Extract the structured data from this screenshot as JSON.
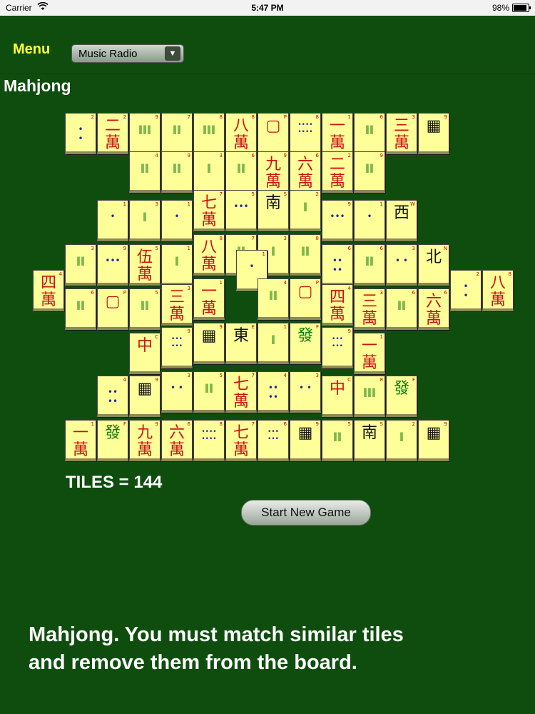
{
  "status_bar": {
    "carrier": "Carrier",
    "time": "5:47 PM",
    "battery": "98%"
  },
  "header": {
    "menu_label": "Menu",
    "radio_select_value": "Music Radio",
    "title": "Mahjong"
  },
  "board": {
    "tiles": [
      {
        "face": "•\n•",
        "style": "blue small",
        "corner": "2"
      },
      {
        "face": "二\n萬",
        "style": "red",
        "corner": "2"
      },
      {
        "face": "‖‖‖",
        "style": "green small",
        "corner": "9"
      },
      {
        "face": "‖‖",
        "style": "green small",
        "corner": "7"
      },
      {
        "face": "‖‖‖",
        "style": "green small",
        "corner": "8"
      },
      {
        "face": "八\n萬",
        "style": "red",
        "corner": "8"
      },
      {
        "face": "▢",
        "style": "red",
        "corner": "P"
      },
      {
        "face": "••••\n••••",
        "style": "blue tiny",
        "corner": "8"
      },
      {
        "face": "一\n萬",
        "style": "red",
        "corner": "1"
      },
      {
        "face": "‖‖",
        "style": "green small",
        "corner": "6"
      },
      {
        "face": "三\n萬",
        "style": "red",
        "corner": "3"
      },
      {
        "face": "▦",
        "style": "black",
        "corner": "9"
      },
      {
        "face": "‖‖",
        "style": "green small",
        "corner": "4"
      },
      {
        "face": "‖‖",
        "style": "green small",
        "corner": "9"
      },
      {
        "face": "‖",
        "style": "green small",
        "corner": "3"
      },
      {
        "face": "‖‖",
        "style": "green small",
        "corner": "6"
      },
      {
        "face": "九\n萬",
        "style": "red",
        "corner": "9"
      },
      {
        "face": "六\n萬",
        "style": "red",
        "corner": "6"
      },
      {
        "face": "二\n萬",
        "style": "red",
        "corner": "2"
      },
      {
        "face": "‖‖",
        "style": "green small",
        "corner": "9"
      },
      {
        "face": "•",
        "style": "blue small",
        "corner": "1"
      },
      {
        "face": "‖",
        "style": "green small",
        "corner": "3"
      },
      {
        "face": "•",
        "style": "blue small",
        "corner": "1"
      },
      {
        "face": "七\n萬",
        "style": "red",
        "corner": "7"
      },
      {
        "face": "•••",
        "style": "blue small",
        "corner": "5"
      },
      {
        "face": "南",
        "style": "black",
        "corner": "S"
      },
      {
        "face": "‖",
        "style": "green small",
        "corner": "2"
      },
      {
        "face": "•••",
        "style": "blue small",
        "corner": "9"
      },
      {
        "face": "•",
        "style": "blue small",
        "corner": "1"
      },
      {
        "face": "西",
        "style": "black",
        "corner": "W"
      },
      {
        "face": "‖‖",
        "style": "green small",
        "corner": "3"
      },
      {
        "face": "•••",
        "style": "blue small",
        "corner": "9"
      },
      {
        "face": "伍\n萬",
        "style": "red",
        "corner": "5"
      },
      {
        "face": "‖",
        "style": "green small",
        "corner": "1"
      },
      {
        "face": "八\n萬",
        "style": "red",
        "corner": "8"
      },
      {
        "face": "‖",
        "style": "green small",
        "corner": "3"
      },
      {
        "face": "‖‖",
        "style": "green small",
        "corner": "8"
      },
      {
        "face": "••\n••",
        "style": "blue small",
        "corner": "6"
      },
      {
        "face": "‖‖",
        "style": "green small",
        "corner": "6"
      },
      {
        "face": "• •",
        "style": "blue small",
        "corner": "3"
      },
      {
        "face": "北",
        "style": "black",
        "corner": "N"
      },
      {
        "face": "‖‖",
        "style": "green small",
        "corner": "7"
      },
      {
        "face": "四\n萬",
        "style": "red",
        "corner": "4"
      },
      {
        "face": "•",
        "style": "blue small",
        "corner": "1"
      },
      {
        "face": "•\n•",
        "style": "blue small",
        "corner": "2"
      },
      {
        "face": "八\n萬",
        "style": "red",
        "corner": "8"
      },
      {
        "face": "‖‖",
        "style": "green small",
        "corner": "6"
      },
      {
        "face": "▢",
        "style": "red",
        "corner": "P"
      },
      {
        "face": "‖‖",
        "style": "green small",
        "corner": "5"
      },
      {
        "face": "三\n萬",
        "style": "red",
        "corner": "3"
      },
      {
        "face": "一\n萬",
        "style": "red",
        "corner": "1"
      },
      {
        "face": "‖‖",
        "style": "green small",
        "corner": "4"
      },
      {
        "face": "▢",
        "style": "red",
        "corner": "P"
      },
      {
        "face": "四\n萬",
        "style": "red",
        "corner": "4"
      },
      {
        "face": "三\n萬",
        "style": "red",
        "corner": "3"
      },
      {
        "face": "‖‖",
        "style": "green small",
        "corner": "6"
      },
      {
        "face": "六\n萬",
        "style": "red",
        "corner": "6"
      },
      {
        "face": "中",
        "style": "red",
        "corner": "C"
      },
      {
        "face": "•••\n•••",
        "style": "blue tiny",
        "corner": "9"
      },
      {
        "face": "▦",
        "style": "black",
        "corner": "9"
      },
      {
        "face": "東",
        "style": "black",
        "corner": "E"
      },
      {
        "face": "‖",
        "style": "green small",
        "corner": "1"
      },
      {
        "face": "發",
        "style": "green",
        "corner": "F"
      },
      {
        "face": "•••\n•••",
        "style": "blue tiny",
        "corner": "9"
      },
      {
        "face": "一\n萬",
        "style": "red",
        "corner": "1"
      },
      {
        "face": "••\n••",
        "style": "blue small",
        "corner": "4"
      },
      {
        "face": "▦",
        "style": "black",
        "corner": "9"
      },
      {
        "face": "• •",
        "style": "blue small",
        "corner": "3"
      },
      {
        "face": "‖‖",
        "style": "green small",
        "corner": "5"
      },
      {
        "face": "七\n萬",
        "style": "red",
        "corner": "7"
      },
      {
        "face": "••\n••",
        "style": "blue small",
        "corner": "4"
      },
      {
        "face": "• •",
        "style": "blue small",
        "corner": "3"
      },
      {
        "face": "中",
        "style": "red",
        "corner": "C"
      },
      {
        "face": "‖‖‖",
        "style": "green small",
        "corner": "8"
      },
      {
        "face": "發",
        "style": "green",
        "corner": "F"
      },
      {
        "face": "一\n萬",
        "style": "red",
        "corner": "1"
      },
      {
        "face": "發",
        "style": "green",
        "corner": "F"
      },
      {
        "face": "九\n萬",
        "style": "red",
        "corner": "9"
      },
      {
        "face": "六\n萬",
        "style": "red",
        "corner": "6"
      },
      {
        "face": "••••\n••••",
        "style": "blue tiny",
        "corner": "8"
      },
      {
        "face": "七\n萬",
        "style": "red",
        "corner": "7"
      },
      {
        "face": "•••\n•••",
        "style": "blue tiny",
        "corner": "6"
      },
      {
        "face": "▦",
        "style": "black",
        "corner": "9"
      },
      {
        "face": "‖‖",
        "style": "green small",
        "corner": "5"
      },
      {
        "face": "南",
        "style": "black",
        "corner": "S"
      },
      {
        "face": "‖",
        "style": "green small",
        "corner": "2"
      },
      {
        "face": "▦",
        "style": "black",
        "corner": "9"
      }
    ]
  },
  "footer": {
    "tiles_count_label": "TILES = 144",
    "start_button_label": "Start New Game",
    "instructions": "Mahjong. You must match similar tiles and remove them from the board."
  }
}
